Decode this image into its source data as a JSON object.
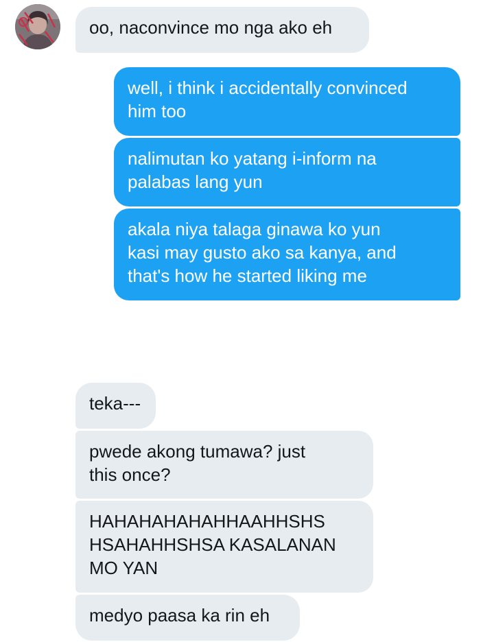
{
  "conversation": {
    "messages": [
      {
        "id": "m1",
        "direction": "incoming",
        "text": "oo, naconvince mo nga ako eh"
      },
      {
        "id": "m2",
        "direction": "outgoing",
        "text": "well, i think i accidentally convinced\nhim too"
      },
      {
        "id": "m3",
        "direction": "outgoing",
        "text": "nalimutan ko yatang i-inform na\npalabas lang yun"
      },
      {
        "id": "m4",
        "direction": "outgoing",
        "text": "akala niya talaga ginawa ko yun\nkasi may gusto ako sa kanya, and\nthat's how he started liking me"
      },
      {
        "id": "m5",
        "direction": "incoming",
        "text": "teka---"
      },
      {
        "id": "m6",
        "direction": "incoming",
        "text": "pwede akong tumawa? just\nthis once?"
      },
      {
        "id": "m7",
        "direction": "incoming",
        "text": "HAHAHAHAHAHHAAHHSHS\nHSAHAHHSHSA KASALANAN\nMO YAN"
      },
      {
        "id": "m8",
        "direction": "incoming",
        "text": "medyo paasa ka rin eh"
      }
    ]
  },
  "colors": {
    "incoming_bubble": "#e6ecf0",
    "outgoing_bubble": "#1da1f2",
    "incoming_text": "#14171a",
    "outgoing_text": "#ffffff"
  },
  "icons": {
    "avatar": "profile-photo"
  }
}
